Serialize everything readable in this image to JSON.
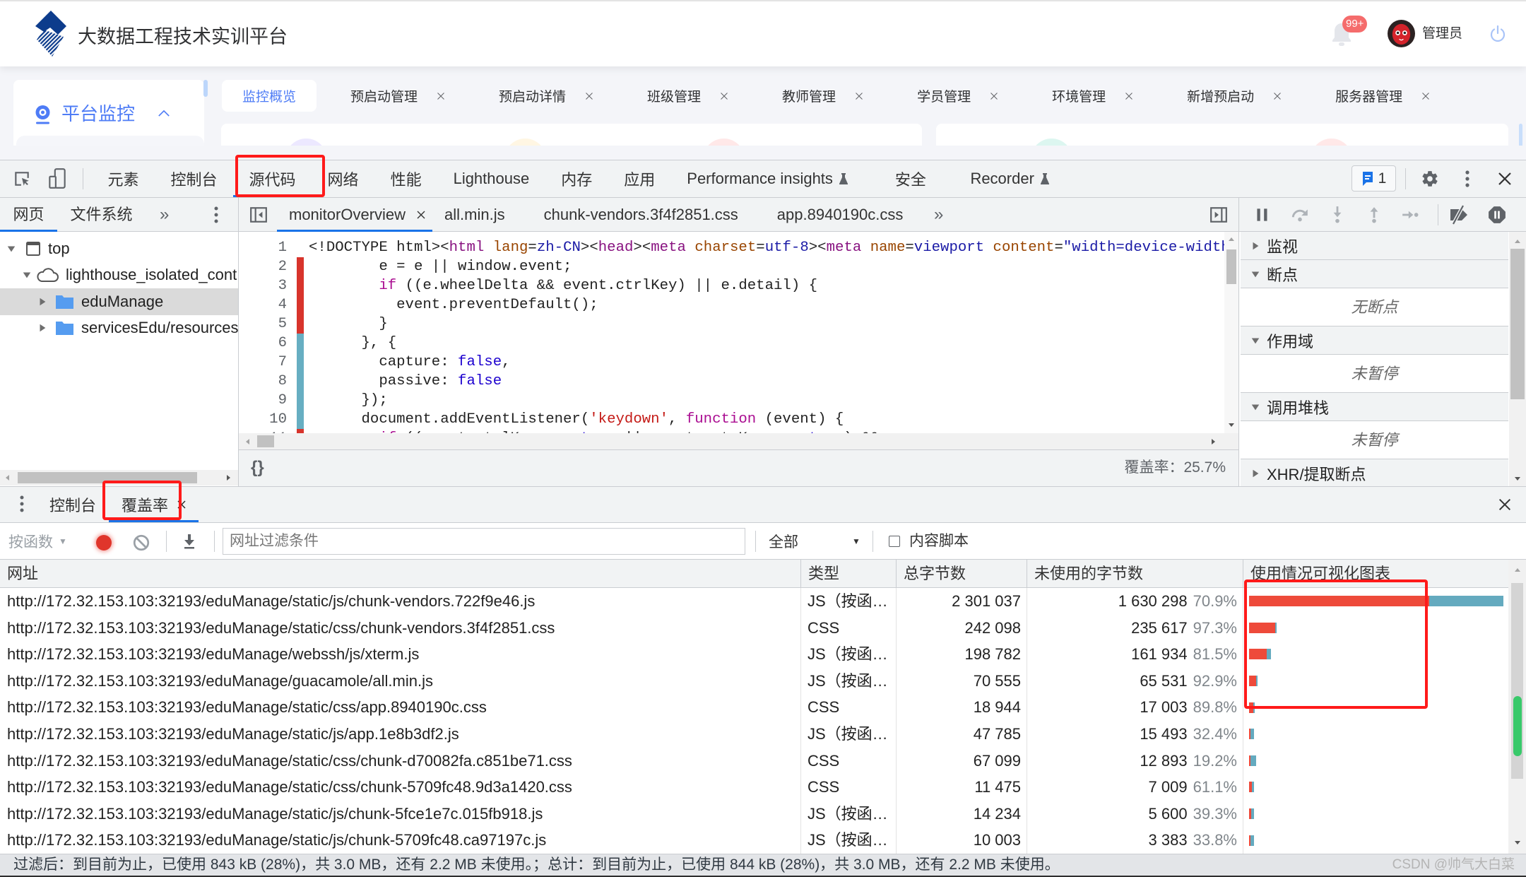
{
  "header": {
    "title": "大数据工程技术实训平台",
    "notification_count": "99+",
    "user_name": "管理员"
  },
  "app": {
    "sidebar": {
      "menu_label": "平台监控",
      "menu_icon": "monitor-icon",
      "expanded": true
    },
    "page_tabs": [
      {
        "label": "监控概览",
        "active": true,
        "closable": false
      },
      {
        "label": "预启动管理",
        "closable": true
      },
      {
        "label": "预启动详情",
        "closable": true
      },
      {
        "label": "班级管理",
        "closable": true
      },
      {
        "label": "教师管理",
        "closable": true
      },
      {
        "label": "学员管理",
        "closable": true
      },
      {
        "label": "环境管理",
        "closable": true
      },
      {
        "label": "新增预启动",
        "closable": true
      },
      {
        "label": "服务器管理",
        "closable": true
      }
    ]
  },
  "devtools": {
    "main_tabs": [
      {
        "label": "元素"
      },
      {
        "label": "控制台"
      },
      {
        "label": "源代码",
        "active": true
      },
      {
        "label": "网络"
      },
      {
        "label": "性能"
      },
      {
        "label": "Lighthouse"
      },
      {
        "label": "内存"
      },
      {
        "label": "应用"
      },
      {
        "label": "Performance insights",
        "experimental": true
      },
      {
        "label": "安全"
      },
      {
        "label": "Recorder",
        "experimental": true
      }
    ],
    "issues_count": "1",
    "more_tabs_glyph": "»",
    "sources": {
      "navigator_tabs": [
        {
          "label": "网页",
          "active": true
        },
        {
          "label": "文件系统"
        }
      ],
      "tree": [
        {
          "label": "top",
          "icon": "frame",
          "expanded": true,
          "children": [
            {
              "label": "lighthouse_isolated_cont",
              "icon": "cloud",
              "expanded": true,
              "children": [
                {
                  "label": "eduManage",
                  "icon": "folder",
                  "expanded": false,
                  "selected": true
                },
                {
                  "label": "servicesEdu/resources/",
                  "icon": "folder",
                  "expanded": false
                }
              ]
            }
          ]
        }
      ],
      "editor_tabs": [
        {
          "label": "monitorOverview",
          "active": true,
          "closable": true
        },
        {
          "label": "all.min.js"
        },
        {
          "label": "chunk-vendors.3f4f2851.css"
        },
        {
          "label": "app.8940190c.css"
        }
      ],
      "code_lines": [
        {
          "n": "1",
          "coverage": "none",
          "tokens": [
            {
              "k": "p",
              "t": "<!DOCTYPE html><"
            },
            {
              "k": "tag",
              "t": "html"
            },
            {
              "k": "p",
              "t": " "
            },
            {
              "k": "attr",
              "t": "lang"
            },
            {
              "k": "p",
              "t": "="
            },
            {
              "k": "val",
              "t": "zh-CN"
            },
            {
              "k": "p",
              "t": "><"
            },
            {
              "k": "tag",
              "t": "head"
            },
            {
              "k": "p",
              "t": "><"
            },
            {
              "k": "tag",
              "t": "meta"
            },
            {
              "k": "p",
              "t": " "
            },
            {
              "k": "attr",
              "t": "charset"
            },
            {
              "k": "p",
              "t": "="
            },
            {
              "k": "val",
              "t": "utf-8"
            },
            {
              "k": "p",
              "t": "><"
            },
            {
              "k": "tag",
              "t": "meta"
            },
            {
              "k": "p",
              "t": " "
            },
            {
              "k": "attr",
              "t": "name"
            },
            {
              "k": "p",
              "t": "="
            },
            {
              "k": "val",
              "t": "viewport"
            },
            {
              "k": "p",
              "t": " "
            },
            {
              "k": "attr",
              "t": "content"
            },
            {
              "k": "p",
              "t": "="
            },
            {
              "k": "val",
              "t": "\"width=device-width"
            }
          ]
        },
        {
          "n": "2",
          "coverage": "unused",
          "tokens": [
            {
              "k": "p",
              "t": "        e = e || window.event;"
            }
          ]
        },
        {
          "n": "3",
          "coverage": "unused",
          "tokens": [
            {
              "k": "p",
              "t": "        "
            },
            {
              "k": "kw",
              "t": "if"
            },
            {
              "k": "p",
              "t": " ((e.wheelDelta && event.ctrlKey) || e.detail) {"
            }
          ]
        },
        {
          "n": "4",
          "coverage": "unused",
          "tokens": [
            {
              "k": "p",
              "t": "          event.preventDefault();"
            }
          ]
        },
        {
          "n": "5",
          "coverage": "unused",
          "tokens": [
            {
              "k": "p",
              "t": "        }"
            }
          ]
        },
        {
          "n": "6",
          "coverage": "used",
          "tokens": [
            {
              "k": "p",
              "t": "      }, {"
            }
          ]
        },
        {
          "n": "7",
          "coverage": "used",
          "tokens": [
            {
              "k": "p",
              "t": "        capture: "
            },
            {
              "k": "atom",
              "t": "false"
            },
            {
              "k": "p",
              "t": ","
            }
          ]
        },
        {
          "n": "8",
          "coverage": "used",
          "tokens": [
            {
              "k": "p",
              "t": "        passive: "
            },
            {
              "k": "atom",
              "t": "false"
            }
          ]
        },
        {
          "n": "9",
          "coverage": "used",
          "tokens": [
            {
              "k": "p",
              "t": "      });"
            }
          ]
        },
        {
          "n": "10",
          "coverage": "used",
          "tokens": [
            {
              "k": "p",
              "t": "      document.addEventListener("
            },
            {
              "k": "str",
              "t": "'keydown'"
            },
            {
              "k": "p",
              "t": ", "
            },
            {
              "k": "kw",
              "t": "function"
            },
            {
              "k": "p",
              "t": " (event) {"
            }
          ]
        },
        {
          "n": "11",
          "coverage": "unused",
          "tokens": [
            {
              "k": "p",
              "t": "        "
            },
            {
              "k": "kw",
              "t": "if"
            },
            {
              "k": "p",
              "t": " ((event.ctrlKey === "
            },
            {
              "k": "atom",
              "t": "true"
            },
            {
              "k": "p",
              "t": " || event.metaKey === "
            },
            {
              "k": "atom",
              "t": "true"
            },
            {
              "k": "p",
              "t": ") &&"
            }
          ]
        }
      ],
      "pretty_print_label": "{}",
      "coverage_summary": "覆盖率：25.7%"
    },
    "debugger": {
      "sections": [
        {
          "title": "监视",
          "expanded": false
        },
        {
          "title": "断点",
          "expanded": true,
          "body": "无断点"
        },
        {
          "title": "作用域",
          "expanded": true,
          "body": "未暂停"
        },
        {
          "title": "调用堆栈",
          "expanded": true,
          "body": "未暂停"
        },
        {
          "title": "XHR/提取断点",
          "expanded": false
        }
      ]
    },
    "drawer": {
      "tabs": [
        {
          "label": "控制台"
        },
        {
          "label": "覆盖率",
          "active": true,
          "closable": true
        }
      ]
    },
    "coverage": {
      "mode_label": "按函数",
      "filter_placeholder": "网址过滤条件",
      "filter_value": "",
      "type_filter": "全部",
      "content_scripts_label": "内容脚本",
      "content_scripts_checked": false,
      "recording": true,
      "columns": {
        "url": "网址",
        "type": "类型",
        "total": "总字节数",
        "unused": "未使用的字节数",
        "viz": "使用情况可视化图表"
      },
      "rows": [
        {
          "url": "http://172.32.153.103:32193/eduManage/static/js/chunk-vendors.722f9e46.js",
          "type": "JS（按函…",
          "total": "2 301 037",
          "unused": "1 630 298",
          "unused_pct": "70.9%",
          "total_bytes": 2301037,
          "unused_fraction": 0.709
        },
        {
          "url": "http://172.32.153.103:32193/eduManage/static/css/chunk-vendors.3f4f2851.css",
          "type": "CSS",
          "total": "242 098",
          "unused": "235 617",
          "unused_pct": "97.3%",
          "total_bytes": 242098,
          "unused_fraction": 0.973
        },
        {
          "url": "http://172.32.153.103:32193/eduManage/webssh/js/xterm.js",
          "type": "JS（按函…",
          "total": "198 782",
          "unused": "161 934",
          "unused_pct": "81.5%",
          "total_bytes": 198782,
          "unused_fraction": 0.815
        },
        {
          "url": "http://172.32.153.103:32193/eduManage/guacamole/all.min.js",
          "type": "JS（按函…",
          "total": "70 555",
          "unused": "65 531",
          "unused_pct": "92.9%",
          "total_bytes": 70555,
          "unused_fraction": 0.929
        },
        {
          "url": "http://172.32.153.103:32193/eduManage/static/css/app.8940190c.css",
          "type": "CSS",
          "total": "18 944",
          "unused": "17 003",
          "unused_pct": "89.8%",
          "total_bytes": 18944,
          "unused_fraction": 0.898
        },
        {
          "url": "http://172.32.153.103:32193/eduManage/static/js/app.1e8b3df2.js",
          "type": "JS（按函…",
          "total": "47 785",
          "unused": "15 493",
          "unused_pct": "32.4%",
          "total_bytes": 47785,
          "unused_fraction": 0.324
        },
        {
          "url": "http://172.32.153.103:32193/eduManage/static/css/chunk-d70082fa.c851be71.css",
          "type": "CSS",
          "total": "67 099",
          "unused": "12 893",
          "unused_pct": "19.2%",
          "total_bytes": 67099,
          "unused_fraction": 0.192
        },
        {
          "url": "http://172.32.153.103:32193/eduManage/static/css/chunk-5709fc48.9d3a1420.css",
          "type": "CSS",
          "total": "11 475",
          "unused": "7 009",
          "unused_pct": "61.1%",
          "total_bytes": 11475,
          "unused_fraction": 0.611
        },
        {
          "url": "http://172.32.153.103:32193/eduManage/static/js/chunk-5fce1e7c.015fb918.js",
          "type": "JS（按函…",
          "total": "14 234",
          "unused": "5 600",
          "unused_pct": "39.3%",
          "total_bytes": 14234,
          "unused_fraction": 0.393
        },
        {
          "url": "http://172.32.153.103:32193/eduManage/static/js/chunk-5709fc48.ca97197c.js",
          "type": "JS（按函…",
          "total": "10 003",
          "unused": "3 383",
          "unused_pct": "33.8%",
          "total_bytes": 10003,
          "unused_fraction": 0.338
        }
      ],
      "status": "过滤后：到目前为止，已使用 843 kB (28%)，共 3.0 MB，还有 2.2 MB 未使用。；总计：到目前为止，已使用 844 kB (28%)，共 3.0 MB，还有 2.2 MB 未使用。"
    }
  },
  "watermark": "CSDN @帅气大白菜",
  "colors": {
    "devtools_accent": "#1a73e8",
    "app_accent": "#4e7cf6",
    "unused_bytes": "#ee4a3a",
    "used_bytes": "#64aabf",
    "annotation_box": "#ff1a1a",
    "badge": "#f56c6c"
  }
}
